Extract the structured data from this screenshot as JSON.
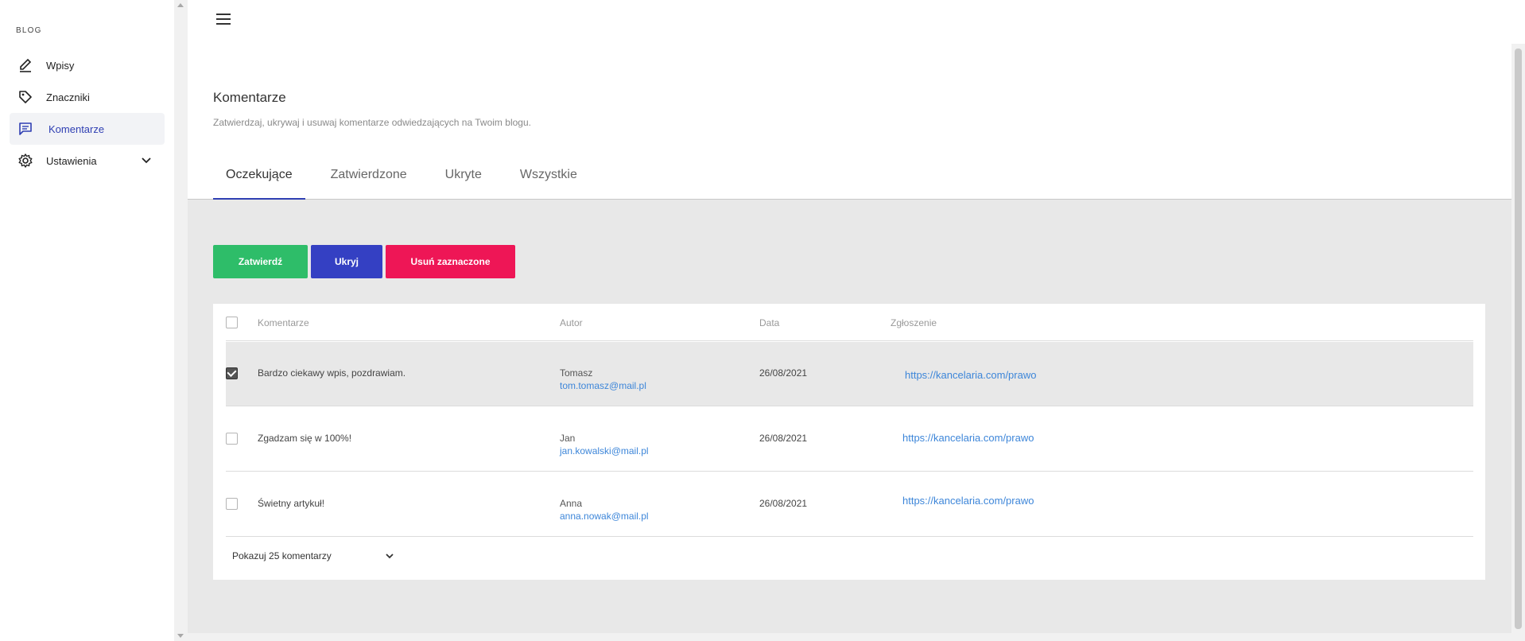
{
  "sidebar": {
    "section_title": "BLOG",
    "items": [
      {
        "label": "Wpisy",
        "icon": "pencil-icon"
      },
      {
        "label": "Znaczniki",
        "icon": "tag-icon"
      },
      {
        "label": "Komentarze",
        "icon": "comment-icon",
        "active": true
      },
      {
        "label": "Ustawienia",
        "icon": "gear-icon",
        "expandable": true
      }
    ]
  },
  "header": {
    "title": "Komentarze",
    "subtitle": "Zatwierdzaj, ukrywaj i usuwaj komentarze odwiedzających na Twoim blogu."
  },
  "tabs": [
    {
      "label": "Oczekujące",
      "active": true
    },
    {
      "label": "Zatwierdzone"
    },
    {
      "label": "Ukryte"
    },
    {
      "label": "Wszystkie"
    }
  ],
  "actions": {
    "approve_label": "Zatwierdź",
    "hide_label": "Ukryj",
    "delete_label": "Usuń zaznaczone"
  },
  "table": {
    "columns": [
      "Komentarze",
      "Autor",
      "Data",
      "Zgłoszenie"
    ],
    "rows": [
      {
        "comment": "Bardzo ciekawy wpis, pozdrawiam.",
        "author": "Tomasz",
        "email": "tom.tomasz@mail.pl",
        "date": "26/08/2021",
        "link": "https://kancelaria.com/prawo",
        "checked": true
      },
      {
        "comment": "Zgadzam się w 100%!",
        "author": "Jan",
        "email": "jan.kowalski@mail.pl",
        "date": "26/08/2021",
        "link": "https://kancelaria.com/prawo",
        "checked": false
      },
      {
        "comment": "Świetny artykuł!",
        "author": "Anna",
        "email": "anna.nowak@mail.pl",
        "date": "26/08/2021",
        "link": "https://kancelaria.com/prawo",
        "checked": false
      }
    ]
  },
  "pagination": {
    "page_size_label": "Pokazuj 25 komentarzy"
  },
  "colors": {
    "accent": "#2f3fb3",
    "approve": "#2ebd69",
    "hide": "#3440c3",
    "delete": "#ee1656",
    "link": "#3d86d9"
  }
}
